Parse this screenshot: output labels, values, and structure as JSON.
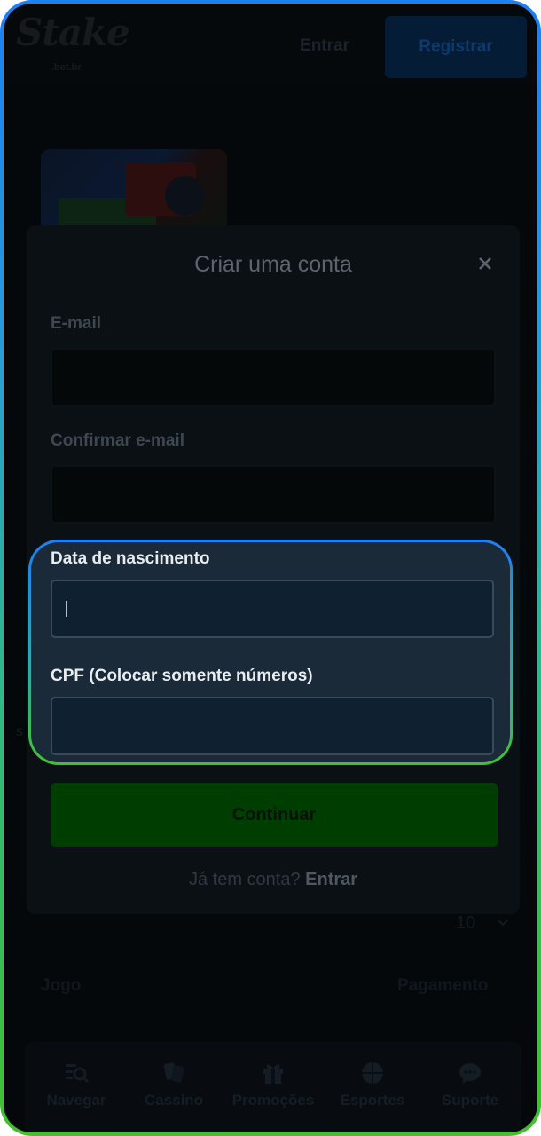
{
  "header": {
    "logo_text": "Stake",
    "logo_subtext": ".bet.br",
    "login_label": "Entrar",
    "register_label": "Registrar"
  },
  "modal": {
    "title": "Criar uma conta",
    "close_icon": "close-icon",
    "fields": {
      "email": {
        "label": "E-mail",
        "value": ""
      },
      "confirm_email": {
        "label": "Confirmar e-mail",
        "value": ""
      },
      "birthdate": {
        "label": "Data de nascimento",
        "value": ""
      },
      "cpf": {
        "label": "CPF (Colocar somente números)",
        "value": ""
      }
    },
    "continue_label": "Continuar",
    "has_account_text": "Já tem conta?",
    "login_link": "Entrar"
  },
  "background": {
    "page_size_value": "10",
    "footer_col_1": "Jogo",
    "footer_col_2": "Pagamento"
  },
  "bottom_nav": {
    "items": [
      {
        "label": "Navegar",
        "icon": "browse-icon"
      },
      {
        "label": "Cassino",
        "icon": "cards-icon"
      },
      {
        "label": "Promoções",
        "icon": "gift-icon"
      },
      {
        "label": "Esportes",
        "icon": "ball-icon"
      },
      {
        "label": "Suporte",
        "icon": "chat-icon"
      }
    ]
  },
  "colors": {
    "highlight_gradient_top": "#1e7ff0",
    "highlight_gradient_bottom": "#43c02e",
    "continue_button": "#003d00",
    "register_button": "#041c36"
  }
}
